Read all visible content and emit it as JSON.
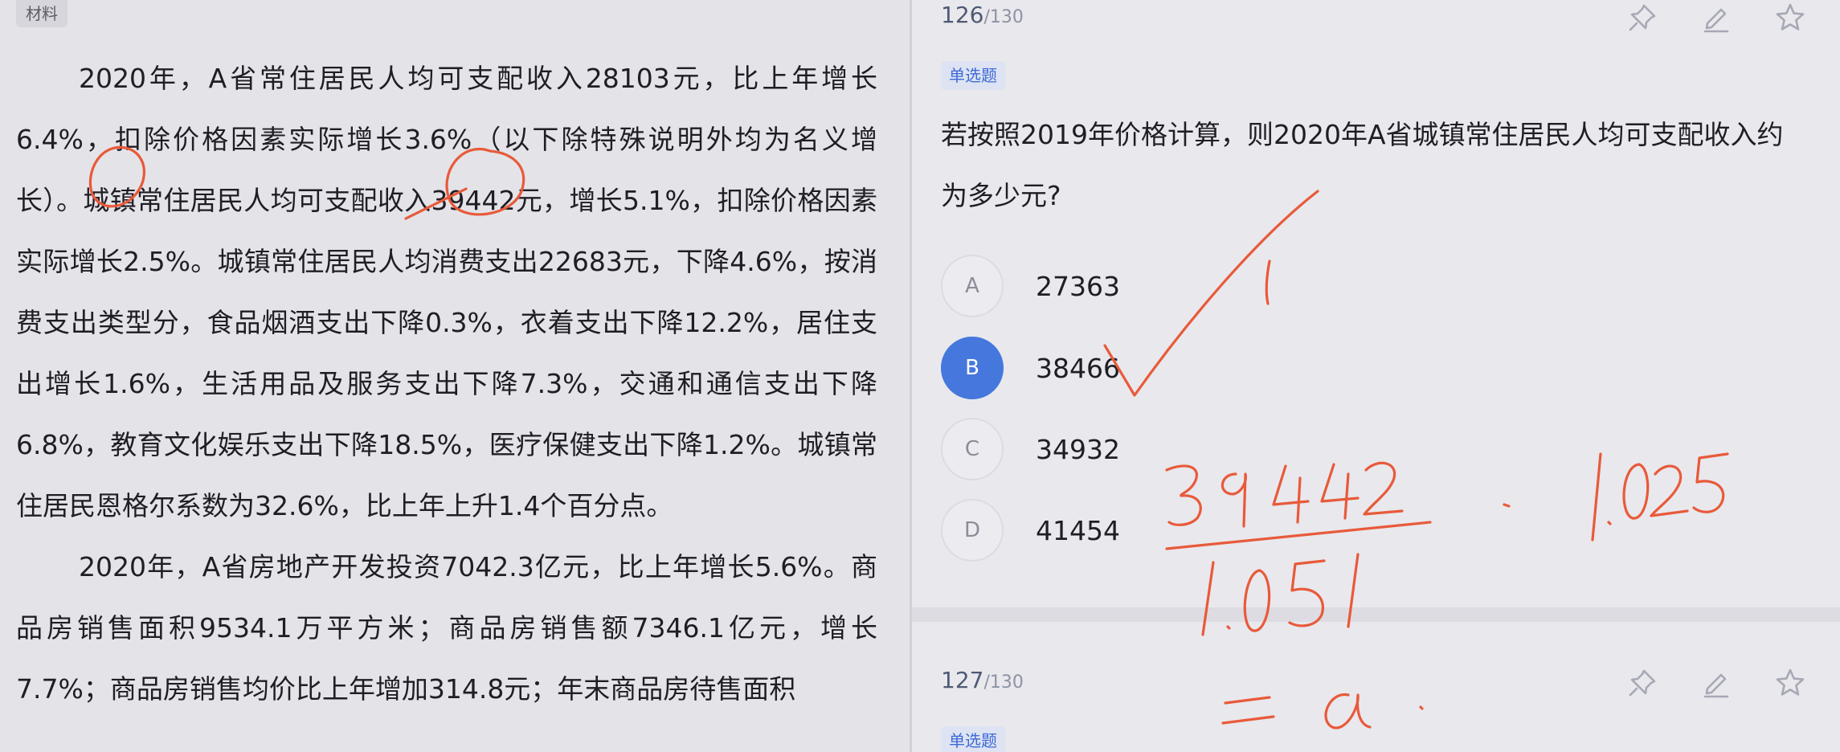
{
  "material": {
    "tag": "材料",
    "paragraphs": [
      "2020年，A省常住居民人均可支配收入28103元，比上年增长6.4%，扣除价格因素实际增长3.6%（以下除特殊说明外均为名义增长）。城镇常住居民人均可支配收入39442元，增长5.1%，扣除价格因素实际增长2.5%。城镇常住居民人均消费支出22683元，下降4.6%，按消费支出类型分，食品烟酒支出下降0.3%，衣着支出下降12.2%，居住支出增长1.6%，生活用品及服务支出下降7.3%，交通和通信支出下降6.8%，教育文化娱乐支出下降18.5%，医疗保健支出下降1.2%。城镇常住居民恩格尔系数为32.6%，比上年上升1.4个百分点。",
      "2020年，A省房地产开发投资7042.3亿元，比上年增长5.6%。商品房销售面积9534.1万平方米；商品房销售额7346.1亿元，增长7.7%；商品房销售均价比上年增加314.8元；年末商品房待售面积"
    ]
  },
  "questions": [
    {
      "number": "126",
      "total": "/130",
      "type": "单选题",
      "stem": "若按照2019年价格计算，则2020年A省城镇常住居民人均可支配收入约为多少元?",
      "options": [
        {
          "letter": "A",
          "text": "27363",
          "selected": false
        },
        {
          "letter": "B",
          "text": "38466",
          "selected": true
        },
        {
          "letter": "C",
          "text": "34932",
          "selected": false
        },
        {
          "letter": "D",
          "text": "41454",
          "selected": false
        }
      ]
    },
    {
      "number": "127",
      "total": "/130",
      "type": "单选题"
    }
  ],
  "toolbar_icons": [
    "pin-icon",
    "edit-icon",
    "star-icon"
  ],
  "colors": {
    "accent": "#4577dd",
    "handwriting": "#e85a3a",
    "badge_text": "#3e6ad6"
  }
}
